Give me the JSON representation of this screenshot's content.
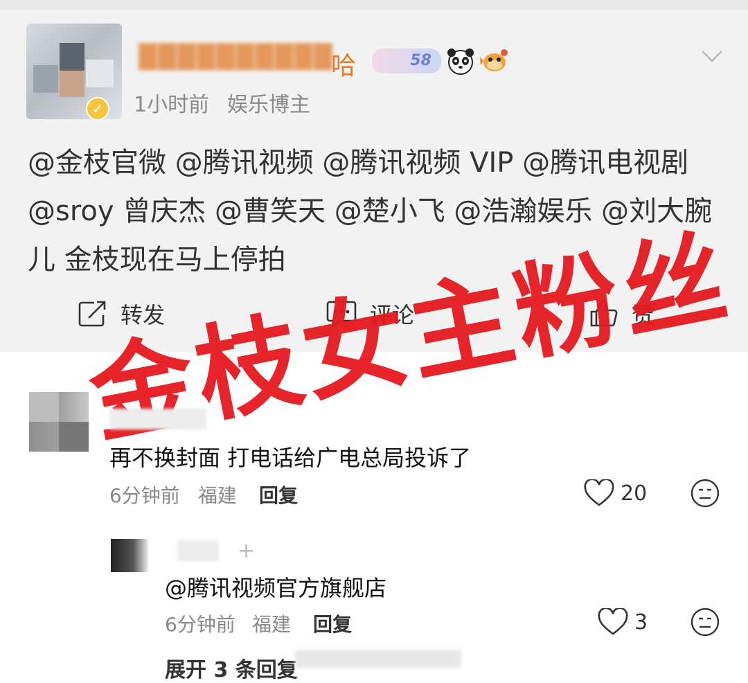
{
  "post": {
    "username_visible_part": "哈",
    "level_badge": "58",
    "time": "1小时前",
    "tag": "娱乐博主",
    "content": "@金枝官微 @腾讯视频 @腾讯视频 VIP @腾讯电视剧  @sroy 曾庆杰 @曹笑天 @楚小飞 @浩瀚娱乐 @刘大腕儿 金枝现在马上停拍",
    "actions": {
      "repost_label": "转发",
      "comment_label": "评论",
      "like_label": "赞"
    }
  },
  "overlay_text": "金枝女主粉丝",
  "comment": {
    "text": "再不换封面 打电话给广电总局投诉了",
    "time": "6分钟前",
    "location": "福建",
    "reply_label": "回复",
    "likes": "20",
    "reply": {
      "text": "@腾讯视频官方旗舰店",
      "time": "6分钟前",
      "location": "福建",
      "reply_label": "回复",
      "likes": "3"
    },
    "expand_label": "展开 3 条回复"
  },
  "colors": {
    "overlay_red": "#e5191f",
    "username_orange": "#e07b2a",
    "post_bg": "#f2f2f2"
  }
}
